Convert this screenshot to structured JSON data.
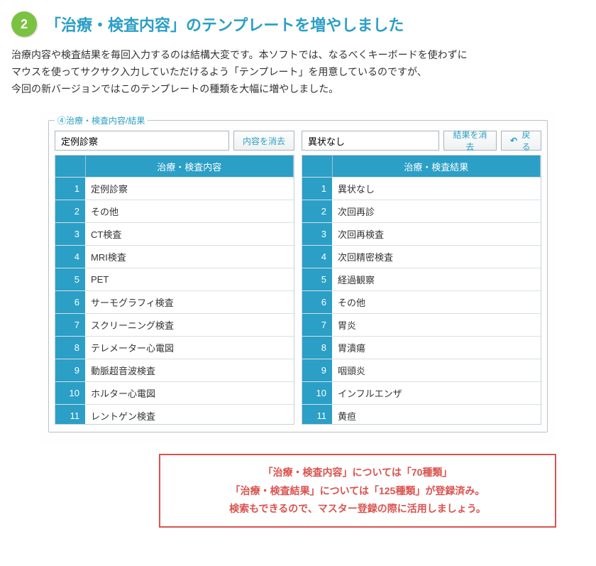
{
  "badge_number": "2",
  "heading": "「治療・検査内容」のテンプレートを増やしました",
  "intro_line1": "治療内容や検査結果を毎回入力するのは結構大変です。本ソフトでは、なるべくキーボードを使わずに",
  "intro_line2": "マウスを使ってサクサク入力していただけるよう「テンプレート」を用意しているのですが、",
  "intro_line3": "今回の新バージョンではこのテンプレートの種類を大幅に増やしました。",
  "section_legend": "④治療・検査内容/結果",
  "left": {
    "input_value": "定例診察",
    "clear_btn": "内容を消去",
    "grid_header": "治療・検査内容",
    "rows": [
      "定例診察",
      "その他",
      "CT検査",
      "MRI検査",
      "PET",
      "サーモグラフィ検査",
      "スクリーニング検査",
      "テレメーター心電図",
      "動脈超音波検査",
      "ホルター心電図",
      "レントゲン検査"
    ]
  },
  "right": {
    "input_value": "異状なし",
    "clear_btn": "結果を消去",
    "back_btn": "戻る",
    "grid_header": "治療・検査結果",
    "rows": [
      "異状なし",
      "次回再診",
      "次回再検査",
      "次回精密検査",
      "経過観察",
      "その他",
      "胃炎",
      "胃潰瘍",
      "咽頭炎",
      "インフルエンザ",
      "黄疸"
    ]
  },
  "callout_line1": "「治療・検査内容」については「70種類」",
  "callout_line2": "「治療・検査結果」については「125種類」が登録済み。",
  "callout_line3": "検索もできるので、マスター登録の際に活用しましょう。"
}
